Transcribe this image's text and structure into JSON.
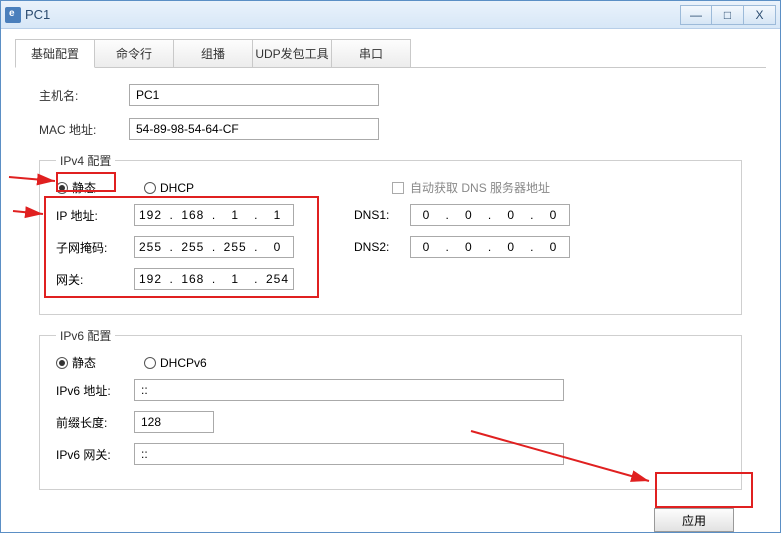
{
  "window": {
    "title": "PC1"
  },
  "winControls": {
    "min": "—",
    "max": "□",
    "close": "X"
  },
  "tabs": [
    "基础配置",
    "命令行",
    "组播",
    "UDP发包工具",
    "串口"
  ],
  "activeTab": 0,
  "host": {
    "label": "主机名:",
    "value": "PC1"
  },
  "mac": {
    "label": "MAC 地址:",
    "value": "54-89-98-54-64-CF"
  },
  "ipv4": {
    "legend": "IPv4 配置",
    "radioStatic": "静态",
    "radioDhcp": "DHCP",
    "autoDns": "自动获取 DNS 服务器地址",
    "ipLabel": "IP 地址:",
    "ip": [
      "192",
      "168",
      "1",
      "1"
    ],
    "maskLabel": "子网掩码:",
    "mask": [
      "255",
      "255",
      "255",
      "0"
    ],
    "gwLabel": "网关:",
    "gw": [
      "192",
      "168",
      "1",
      "254"
    ],
    "dns1Label": "DNS1:",
    "dns1": [
      "0",
      "0",
      "0",
      "0"
    ],
    "dns2Label": "DNS2:",
    "dns2": [
      "0",
      "0",
      "0",
      "0"
    ]
  },
  "ipv6": {
    "legend": "IPv6 配置",
    "radioStatic": "静态",
    "radioDhcp": "DHCPv6",
    "addrLabel": "IPv6 地址:",
    "addr": "::",
    "prefixLabel": "前缀长度:",
    "prefix": "128",
    "gwLabel": "IPv6 网关:",
    "gw": "::"
  },
  "applyLabel": "应用"
}
